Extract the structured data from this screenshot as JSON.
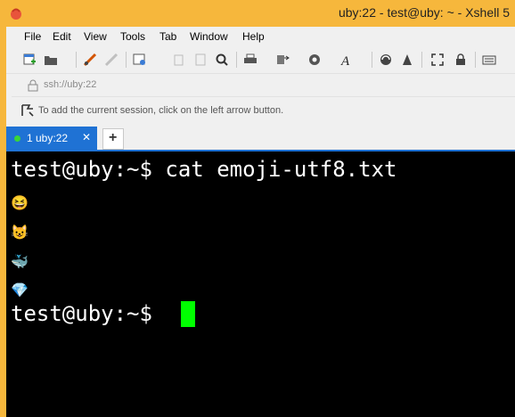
{
  "window": {
    "title": "uby:22 - test@uby: ~ - Xshell 5",
    "app_icon": "xshell-logo-icon"
  },
  "menu": {
    "items": [
      "File",
      "Edit",
      "View",
      "Tools",
      "Tab",
      "Window",
      "Help"
    ]
  },
  "toolbar": {
    "icons": [
      "new-session-icon",
      "open-folder-icon",
      "connect-icon",
      "disconnect-icon",
      "properties-icon",
      "copy-icon",
      "paste-icon",
      "find-icon",
      "print-icon",
      "transfer-icon",
      "globe-icon",
      "font-icon",
      "xftp-icon",
      "xagent-icon",
      "fullscreen-icon",
      "lock-icon",
      "keyboard-icon"
    ]
  },
  "address_bar": {
    "value": "ssh://uby:22"
  },
  "hint_bar": {
    "text": "To add the current session, click on the left arrow button."
  },
  "tabs": [
    {
      "label": "1 uby:22",
      "active": true,
      "status_color": "#39d639"
    }
  ],
  "terminal": {
    "background": "#000000",
    "foreground": "#ffffff",
    "cursor_color": "#00ff00",
    "lines": [
      "test@uby:~$ cat emoji-utf8.txt",
      "😆",
      "😺",
      "🐳",
      "💎",
      "test@uby:~$ "
    ]
  },
  "colors": {
    "frame": "#f6b73c",
    "tab_active": "#1f72d4"
  }
}
